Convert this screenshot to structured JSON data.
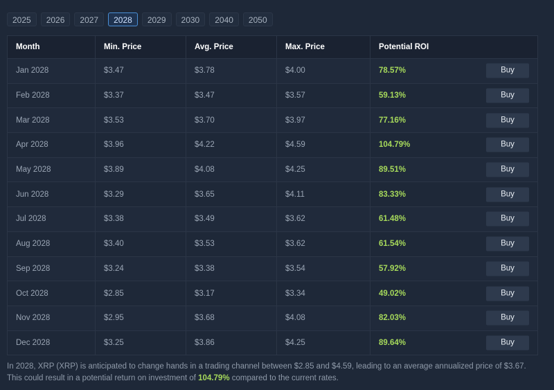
{
  "years": [
    "2025",
    "2026",
    "2027",
    "2028",
    "2029",
    "2030",
    "2040",
    "2050"
  ],
  "active_year": "2028",
  "table": {
    "headers": [
      "Month",
      "Min. Price",
      "Avg. Price",
      "Max. Price",
      "Potential ROI"
    ],
    "rows": [
      {
        "month": "Jan 2028",
        "min": "$3.47",
        "avg": "$3.78",
        "max": "$4.00",
        "roi": "78.57%",
        "action": "Buy"
      },
      {
        "month": "Feb 2028",
        "min": "$3.37",
        "avg": "$3.47",
        "max": "$3.57",
        "roi": "59.13%",
        "action": "Buy"
      },
      {
        "month": "Mar 2028",
        "min": "$3.53",
        "avg": "$3.70",
        "max": "$3.97",
        "roi": "77.16%",
        "action": "Buy"
      },
      {
        "month": "Apr 2028",
        "min": "$3.96",
        "avg": "$4.22",
        "max": "$4.59",
        "roi": "104.79%",
        "action": "Buy"
      },
      {
        "month": "May 2028",
        "min": "$3.89",
        "avg": "$4.08",
        "max": "$4.25",
        "roi": "89.51%",
        "action": "Buy"
      },
      {
        "month": "Jun 2028",
        "min": "$3.29",
        "avg": "$3.65",
        "max": "$4.11",
        "roi": "83.33%",
        "action": "Buy"
      },
      {
        "month": "Jul 2028",
        "min": "$3.38",
        "avg": "$3.49",
        "max": "$3.62",
        "roi": "61.48%",
        "action": "Buy"
      },
      {
        "month": "Aug 2028",
        "min": "$3.40",
        "avg": "$3.53",
        "max": "$3.62",
        "roi": "61.54%",
        "action": "Buy"
      },
      {
        "month": "Sep 2028",
        "min": "$3.24",
        "avg": "$3.38",
        "max": "$3.54",
        "roi": "57.92%",
        "action": "Buy"
      },
      {
        "month": "Oct 2028",
        "min": "$2.85",
        "avg": "$3.17",
        "max": "$3.34",
        "roi": "49.02%",
        "action": "Buy"
      },
      {
        "month": "Nov 2028",
        "min": "$2.95",
        "avg": "$3.68",
        "max": "$4.08",
        "roi": "82.03%",
        "action": "Buy"
      },
      {
        "month": "Dec 2028",
        "min": "$3.25",
        "avg": "$3.86",
        "max": "$4.25",
        "roi": "89.64%",
        "action": "Buy"
      }
    ]
  },
  "summary": {
    "before": "In 2028, XRP (XRP) is anticipated to change hands in a trading channel between $2.85 and $4.59, leading to an average annualized price of $3.67. This could result in a potential return on investment of ",
    "highlight": "104.79%",
    "after": " compared to the current rates."
  },
  "colors": {
    "background": "#1e2838",
    "roi_green": "#a6d95b",
    "active_tab_border": "#4a8fd6"
  }
}
